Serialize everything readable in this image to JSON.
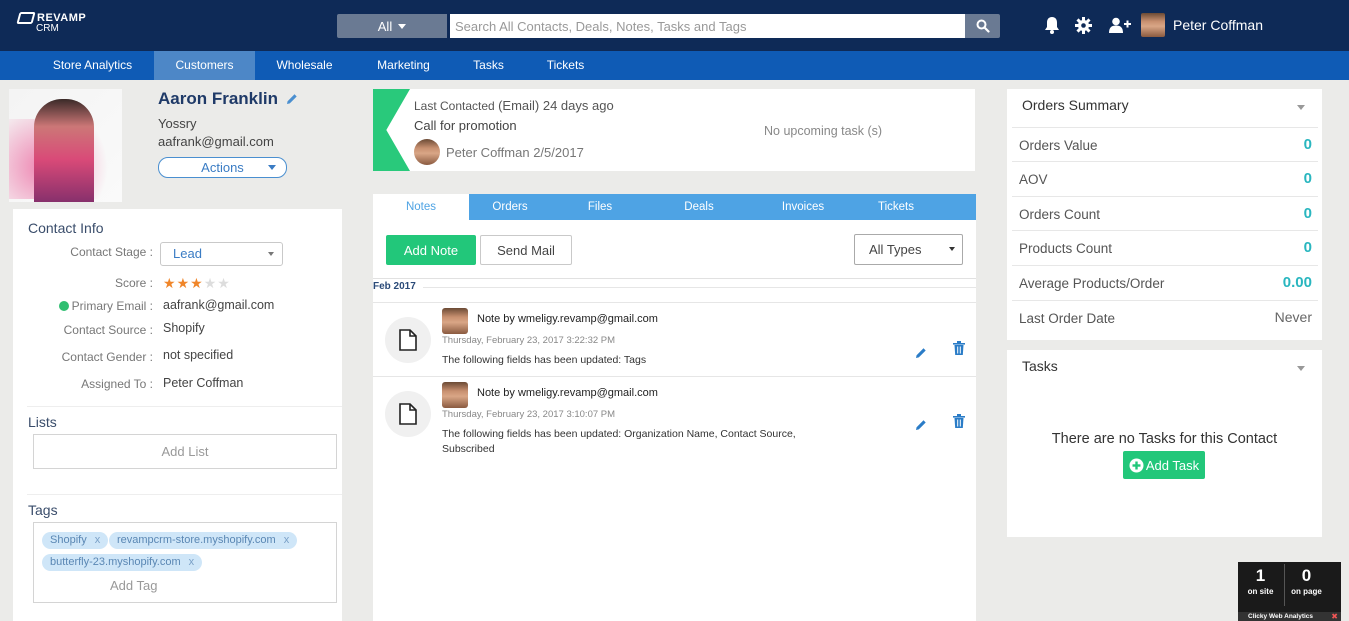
{
  "header": {
    "logo_line1": "REVAMP",
    "logo_line2": "CRM",
    "search_filter": "All",
    "search_placeholder": "Search All Contacts, Deals, Notes, Tasks and Tags",
    "user_name": "Peter Coffman"
  },
  "nav": {
    "items": [
      {
        "label": "Store Analytics",
        "active": false
      },
      {
        "label": "Customers",
        "active": true
      },
      {
        "label": "Wholesale",
        "active": false
      },
      {
        "label": "Marketing",
        "active": false
      },
      {
        "label": "Tasks",
        "active": false
      },
      {
        "label": "Tickets",
        "active": false
      }
    ]
  },
  "contact": {
    "name": "Aaron Franklin",
    "company": "Yossry",
    "email": "aafrank@gmail.com",
    "actions_label": "Actions"
  },
  "contact_info": {
    "title": "Contact Info",
    "stage_label": "Contact Stage :",
    "stage_value": "Lead",
    "score_label": "Score :",
    "score_rating": 3,
    "score_max": 5,
    "email_label": "Primary Email :",
    "email_value": "aafrank@gmail.com",
    "source_label": "Contact Source :",
    "source_value": "Shopify",
    "gender_label": "Contact Gender :",
    "gender_value": "not specified",
    "assigned_label": "Assigned To :",
    "assigned_value": "Peter Coffman"
  },
  "lists": {
    "title": "Lists",
    "add_label": "Add List"
  },
  "tags": {
    "title": "Tags",
    "items": [
      "Shopify",
      "revampcrm-store.myshopify.com",
      "butterfly-23.myshopify.com"
    ],
    "remove_glyph": "x",
    "add_label": "Add Tag"
  },
  "last_contact": {
    "prefix": "Last Contacted",
    "detail": "(Email) 24 days ago",
    "subject": "Call for promotion",
    "user": "Peter Coffman 2/5/2017",
    "no_task": "No upcoming task (s)"
  },
  "activity": {
    "tabs": [
      {
        "label": "Notes",
        "active": true
      },
      {
        "label": "Orders",
        "active": false
      },
      {
        "label": "Files",
        "active": false
      },
      {
        "label": "Deals",
        "active": false
      },
      {
        "label": "Invoices",
        "active": false
      },
      {
        "label": "Tickets",
        "active": false
      }
    ],
    "add_note_label": "Add Note",
    "send_mail_label": "Send Mail",
    "type_filter": "All Types",
    "date_group": "Feb 2017",
    "notes": [
      {
        "author": "Note by wmeligy.revamp@gmail.com",
        "time": "Thursday, February 23, 2017 3:22:32 PM",
        "text": "The following fields has been updated: Tags"
      },
      {
        "author": "Note by wmeligy.revamp@gmail.com",
        "time": "Thursday, February 23, 2017 3:10:07 PM",
        "text": "The following fields has been updated: Organization Name, Contact Source, Subscribed"
      }
    ]
  },
  "orders_summary": {
    "title": "Orders Summary",
    "rows": [
      {
        "label": "Orders Value",
        "value": "0"
      },
      {
        "label": "AOV",
        "value": "0"
      },
      {
        "label": "Orders Count",
        "value": "0"
      },
      {
        "label": "Products Count",
        "value": "0"
      },
      {
        "label": "Average Products/Order",
        "value": "0.00"
      },
      {
        "label": "Last Order Date",
        "value": "Never"
      }
    ]
  },
  "tasks": {
    "title": "Tasks",
    "empty_text": "There are no Tasks for this Contact",
    "add_label": "Add Task"
  },
  "clicky": {
    "on_site_count": "1",
    "on_site_label": "on site",
    "on_page_count": "0",
    "on_page_label": "on page",
    "footer": "Clicky Web Analytics",
    "close_glyph": "✖"
  },
  "colors": {
    "topbar": "#0e2a57",
    "nav": "#0f5bb5",
    "accent_green": "#22c77a",
    "accent_teal": "#29b6bf",
    "tab_blue": "#4ea3e4",
    "star_filled": "#f0862a",
    "star_empty": "#dddddd"
  }
}
